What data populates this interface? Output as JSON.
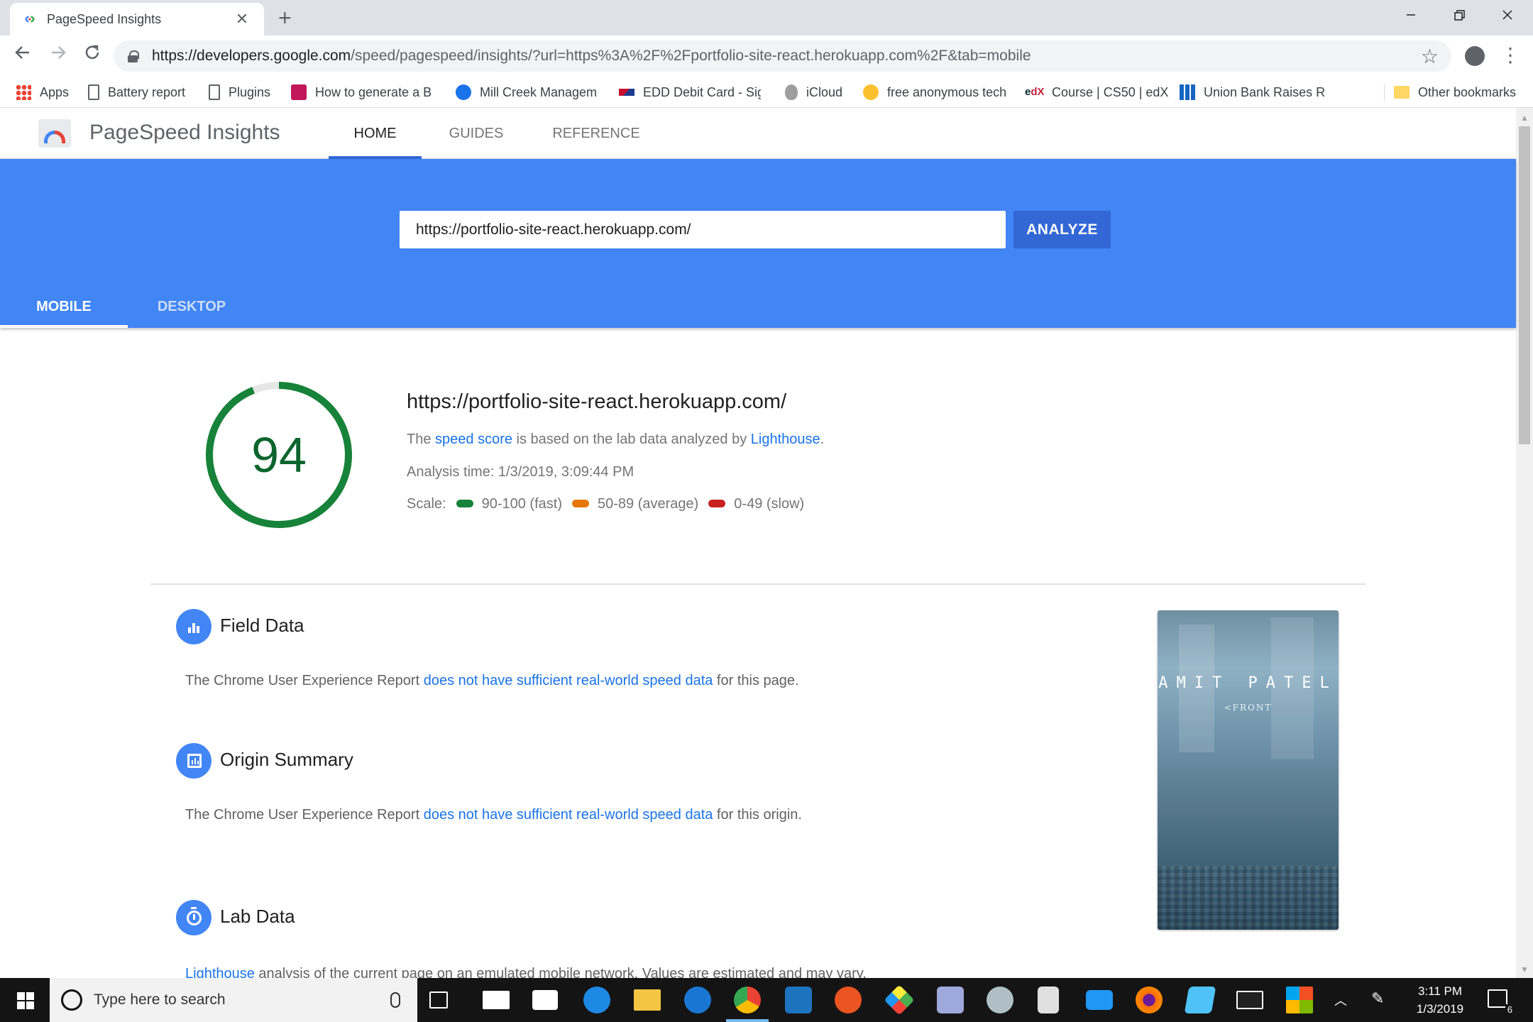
{
  "browser": {
    "tab_title": "PageSpeed Insights",
    "tab_close": "✕",
    "new_tab": "+",
    "url_host": "https://developers.google.com",
    "url_rest": "/speed/pagespeed/insights/?url=https%3A%2F%2Fportfolio-site-react.herokuapp.com%2F&tab=mobile",
    "bookmarks": [
      {
        "label": "Apps",
        "icon": "apps-grid-icon"
      },
      {
        "label": "Battery report",
        "icon": "page-icon"
      },
      {
        "label": "Plugins",
        "icon": "page-icon"
      },
      {
        "label": "How to generate a B",
        "icon": "site-icon"
      },
      {
        "label": "Mill Creek Managem",
        "icon": "site-icon"
      },
      {
        "label": "EDD Debit Card - Sig",
        "icon": "site-icon"
      },
      {
        "label": "iCloud",
        "icon": "apple-icon"
      },
      {
        "label": "free anonymous tech",
        "icon": "site-icon"
      },
      {
        "label": "Course | CS50 | edX",
        "icon": "edx-icon"
      },
      {
        "label": "Union Bank Raises Ra",
        "icon": "site-icon"
      },
      {
        "label": "Other bookmarks",
        "icon": "folder-icon"
      }
    ]
  },
  "psi": {
    "brand": "PageSpeed Insights",
    "nav": [
      "HOME",
      "GUIDES",
      "REFERENCE"
    ],
    "input_value": "https://portfolio-site-react.herokuapp.com/",
    "analyze_label": "ANALYZE",
    "device_tabs": [
      "MOBILE",
      "DESKTOP"
    ]
  },
  "score": {
    "value": 94,
    "value_text": "94",
    "color": "#0d652d",
    "tested_url": "https://portfolio-site-react.herokuapp.com/",
    "desc_prefix": "The ",
    "desc_link1": "speed score",
    "desc_mid": " is based on the lab data analyzed by ",
    "desc_link2": "Lighthouse",
    "desc_suffix": ".",
    "analysis_time": "Analysis time: 1/3/2019, 3:09:44 PM",
    "scale_label": "Scale:",
    "scale": [
      {
        "label": "90-100 (fast)",
        "color": "#178239"
      },
      {
        "label": "50-89 (average)",
        "color": "#e67700"
      },
      {
        "label": "0-49 (slow)",
        "color": "#c7221f"
      }
    ]
  },
  "field_data": {
    "title": "Field Data",
    "prefix": "The Chrome User Experience Report ",
    "link": "does not have sufficient real-world speed data",
    "suffix": " for this page."
  },
  "origin_summary": {
    "title": "Origin Summary",
    "prefix": "The Chrome User Experience Report ",
    "link": "does not have sufficient real-world speed data",
    "suffix": " for this origin."
  },
  "lab_data": {
    "title": "Lab Data",
    "link": "Lighthouse",
    "text": " analysis of the current page on an emulated mobile network. Values are estimated and may vary."
  },
  "thumbnail": {
    "name": "AMIT PATEL",
    "sub": "<FRONT"
  },
  "taskbar": {
    "search_placeholder": "Type here to search",
    "time": "3:11 PM",
    "date": "1/3/2019",
    "notifications": "6"
  }
}
